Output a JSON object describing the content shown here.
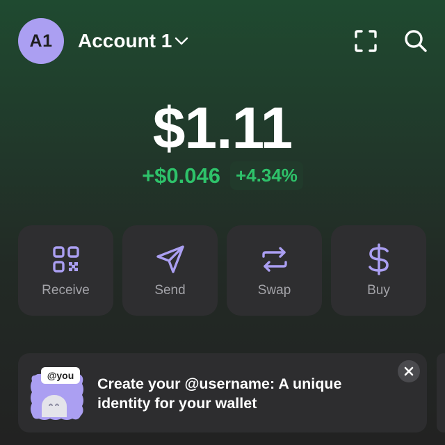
{
  "header": {
    "avatar_initials": "A1",
    "account_name": "Account 1"
  },
  "wallet": {
    "balance": "$1.11",
    "change_amount": "+$0.046",
    "change_percent": "+4.34%"
  },
  "actions": [
    {
      "label": "Receive",
      "icon": "qr-code-icon"
    },
    {
      "label": "Send",
      "icon": "send-icon"
    },
    {
      "label": "Swap",
      "icon": "swap-icon"
    },
    {
      "label": "Buy",
      "icon": "dollar-icon"
    }
  ],
  "banner": {
    "tag": "@you",
    "text": "Create your @username: A unique identity for your wallet"
  },
  "colors": {
    "accent": "#ab9ff2",
    "positive": "#2ec26a",
    "card": "#2e2e30"
  }
}
